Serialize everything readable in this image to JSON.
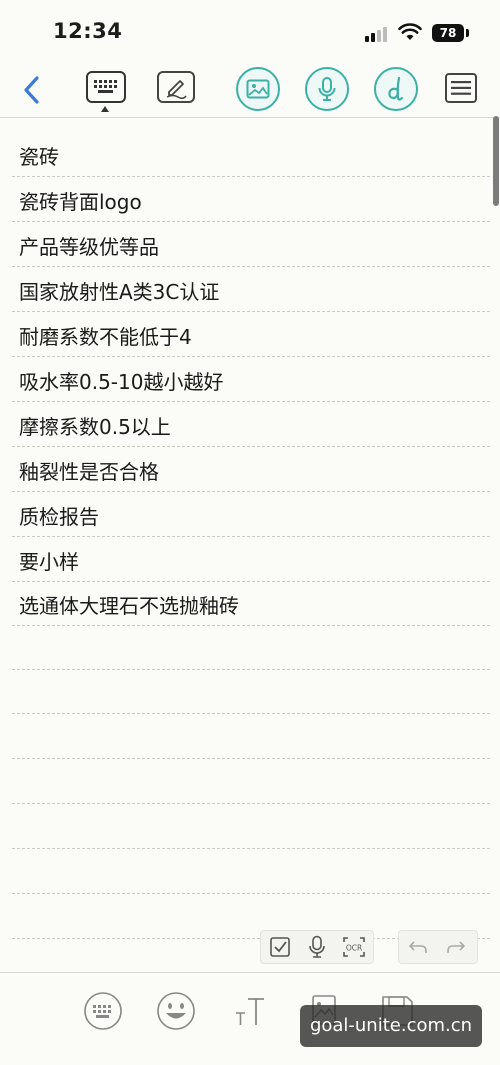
{
  "status_bar": {
    "time": "12:34",
    "battery": "78"
  },
  "toolbar": {
    "icons": [
      "back-chevron-icon",
      "keyboard-icon",
      "pen-icon",
      "image-icon",
      "microphone-icon",
      "script-d-icon",
      "menu-icon"
    ],
    "accent_color": "#3bb1a6",
    "back_color": "#3a7bd5"
  },
  "note": {
    "lines": [
      "瓷砖",
      "瓷砖背面logo",
      "产品等级优等品",
      "国家放射性A类3C认证",
      "耐磨系数不能低于4",
      "吸水率0.5-10越小越好",
      "摩擦系数0.5以上",
      "釉裂性是否合格",
      "质检报告",
      "要小样",
      "选通体大理石不选抛釉砖"
    ]
  },
  "mini_toolbar": {
    "ocr_label": "OCR",
    "icons": [
      "checkbox-icon",
      "microphone-icon",
      "ocr-icon",
      "undo-icon",
      "redo-icon"
    ]
  },
  "bottom_bar": {
    "icons": [
      "keyboard-icon",
      "emoji-icon",
      "text-size-icon",
      "image-icon",
      "save-icon"
    ]
  },
  "watermark": {
    "text": "goal-unite.com.cn"
  }
}
